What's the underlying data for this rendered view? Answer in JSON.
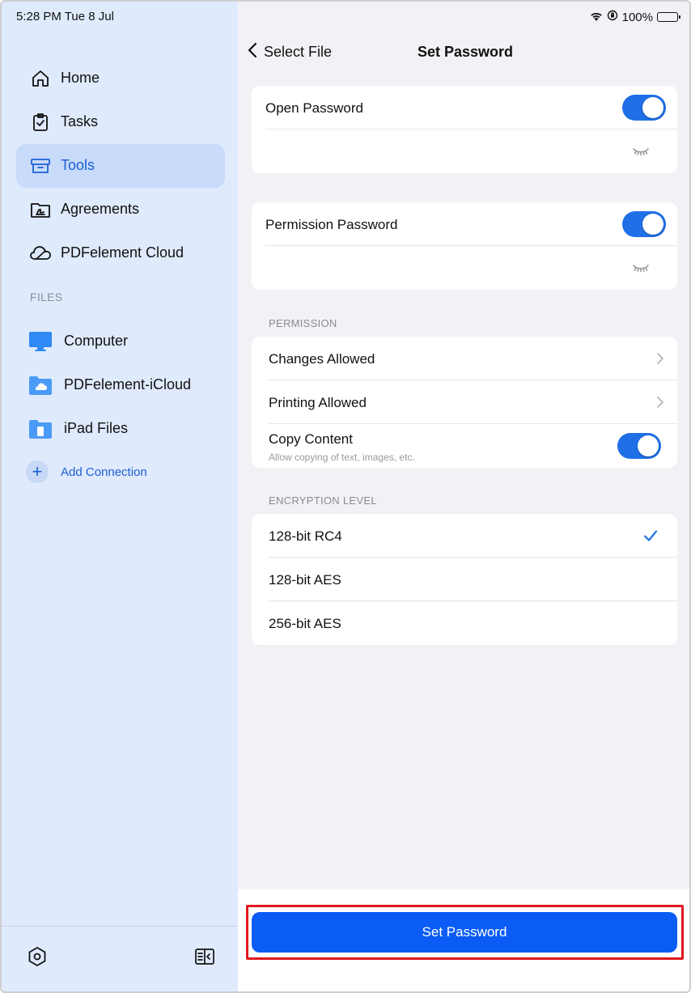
{
  "status": {
    "time_date": "5:28 PM  Tue 8 Jul",
    "battery": "100%"
  },
  "sidebar": {
    "nav": [
      {
        "label": "Home",
        "icon": "home-icon"
      },
      {
        "label": "Tasks",
        "icon": "tasks-icon"
      },
      {
        "label": "Tools",
        "icon": "tools-icon",
        "active": true
      },
      {
        "label": "Agreements",
        "icon": "agreements-icon"
      },
      {
        "label": "PDFelement Cloud",
        "icon": "cloud-icon"
      }
    ],
    "files_header": "FILES",
    "files": [
      {
        "label": "Computer",
        "icon": "computer-icon"
      },
      {
        "label": "PDFelement-iCloud",
        "icon": "icloud-folder-icon"
      },
      {
        "label": "iPad Files",
        "icon": "ipad-folder-icon"
      }
    ],
    "add_connection": "Add Connection"
  },
  "header": {
    "back_label": "Select File",
    "title": "Set Password"
  },
  "open_password": {
    "label": "Open Password",
    "enabled": true,
    "value": ""
  },
  "permission_password": {
    "label": "Permission Password",
    "enabled": true,
    "value": ""
  },
  "permission": {
    "header": "PERMISSION",
    "changes_allowed": "Changes Allowed",
    "printing_allowed": "Printing Allowed",
    "copy_content": "Copy Content",
    "copy_content_sub": "Allow copying of text, images, etc.",
    "copy_content_enabled": true
  },
  "encryption": {
    "header": "ENCRYPTION LEVEL",
    "options": [
      "128-bit RC4",
      "128-bit AES",
      "256-bit AES"
    ],
    "selected": "128-bit RC4"
  },
  "footer": {
    "button_label": "Set Password"
  },
  "colors": {
    "accent": "#0a5cf5",
    "toggle_on": "#1f6fe6",
    "sidebar_bg": "#dfeafc",
    "highlight_border": "#e0171f"
  }
}
